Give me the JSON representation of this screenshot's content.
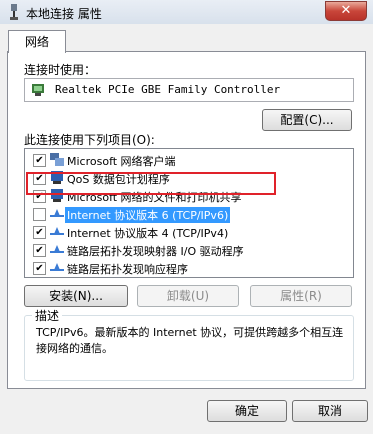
{
  "window": {
    "title": "本地连接 属性",
    "close_glyph": "✕"
  },
  "tabs": [
    {
      "label": "网络"
    }
  ],
  "connect_using": {
    "label": "连接时使用：",
    "adapter": "Realtek PCIe GBE Family Controller",
    "configure_button": "配置(C)..."
  },
  "items_section": {
    "label": "此连接使用下列项目(O):",
    "items": [
      {
        "label": "Microsoft 网络客户端",
        "checked": true,
        "icon": "network-client-icon"
      },
      {
        "label": "QoS 数据包计划程序",
        "checked": true,
        "icon": "qos-icon"
      },
      {
        "label": "Microsoft 网络的文件和打印机共享",
        "checked": true,
        "icon": "file-share-icon"
      },
      {
        "label": "Internet 协议版本 6 (TCP/IPv6)",
        "checked": false,
        "selected": true,
        "icon": "protocol-icon"
      },
      {
        "label": "Internet 协议版本 4 (TCP/IPv4)",
        "checked": true,
        "icon": "protocol-icon"
      },
      {
        "label": "链路层拓扑发现映射器 I/O 驱动程序",
        "checked": true,
        "icon": "protocol-icon"
      },
      {
        "label": "链路层拓扑发现响应程序",
        "checked": true,
        "icon": "protocol-icon"
      }
    ]
  },
  "buttons": {
    "install": "安装(N)...",
    "uninstall": "卸载(U)",
    "properties": "属性(R)"
  },
  "description": {
    "label": "描述",
    "text": "TCP/IPv6。最新版本的 Internet 协议，可提供跨越多个相互连接网络的通信。"
  },
  "footer": {
    "ok": "确定",
    "cancel": "取消"
  }
}
